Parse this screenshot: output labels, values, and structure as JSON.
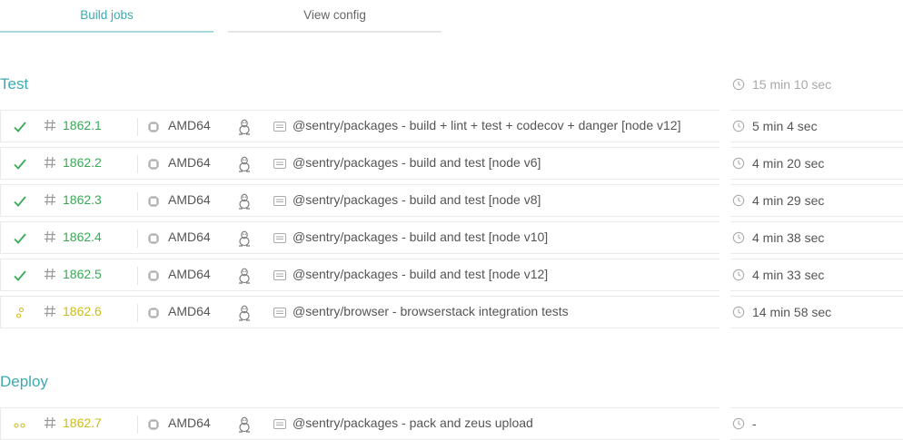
{
  "tabs": [
    {
      "label": "Build jobs",
      "active": true
    },
    {
      "label": "View config",
      "active": false
    }
  ],
  "stages": [
    {
      "title": "Test",
      "duration": "15 min 10 sec",
      "jobs": [
        {
          "status": "passed",
          "number": "1862.1",
          "arch": "AMD64",
          "os": "linux-icon",
          "name": "@sentry/packages - build + lint + test + codecov + danger [node v12]",
          "duration": "5 min 4 sec"
        },
        {
          "status": "passed",
          "number": "1862.2",
          "arch": "AMD64",
          "os": "linux-icon",
          "name": "@sentry/packages - build and test [node v6]",
          "duration": "4 min 20 sec"
        },
        {
          "status": "passed",
          "number": "1862.3",
          "arch": "AMD64",
          "os": "linux-icon",
          "name": "@sentry/packages - build and test [node v8]",
          "duration": "4 min 29 sec"
        },
        {
          "status": "passed",
          "number": "1862.4",
          "arch": "AMD64",
          "os": "linux-icon",
          "name": "@sentry/packages - build and test [node v10]",
          "duration": "4 min 38 sec"
        },
        {
          "status": "passed",
          "number": "1862.5",
          "arch": "AMD64",
          "os": "linux-icon",
          "name": "@sentry/packages - build and test [node v12]",
          "duration": "4 min 33 sec"
        },
        {
          "status": "running",
          "number": "1862.6",
          "arch": "AMD64",
          "os": "linux-icon",
          "name": "@sentry/browser - browserstack integration tests",
          "duration": "14 min 58 sec"
        }
      ]
    },
    {
      "title": "Deploy",
      "duration": "",
      "jobs": [
        {
          "status": "created",
          "number": "1862.7",
          "arch": "AMD64",
          "os": "linux-icon",
          "name": "@sentry/packages - pack and zeus upload",
          "duration": "-"
        }
      ]
    }
  ],
  "colors": {
    "accent": "#3eaaaf",
    "passed": "#39aa56",
    "running": "#cdbc1c",
    "border": "#eaeaea"
  }
}
